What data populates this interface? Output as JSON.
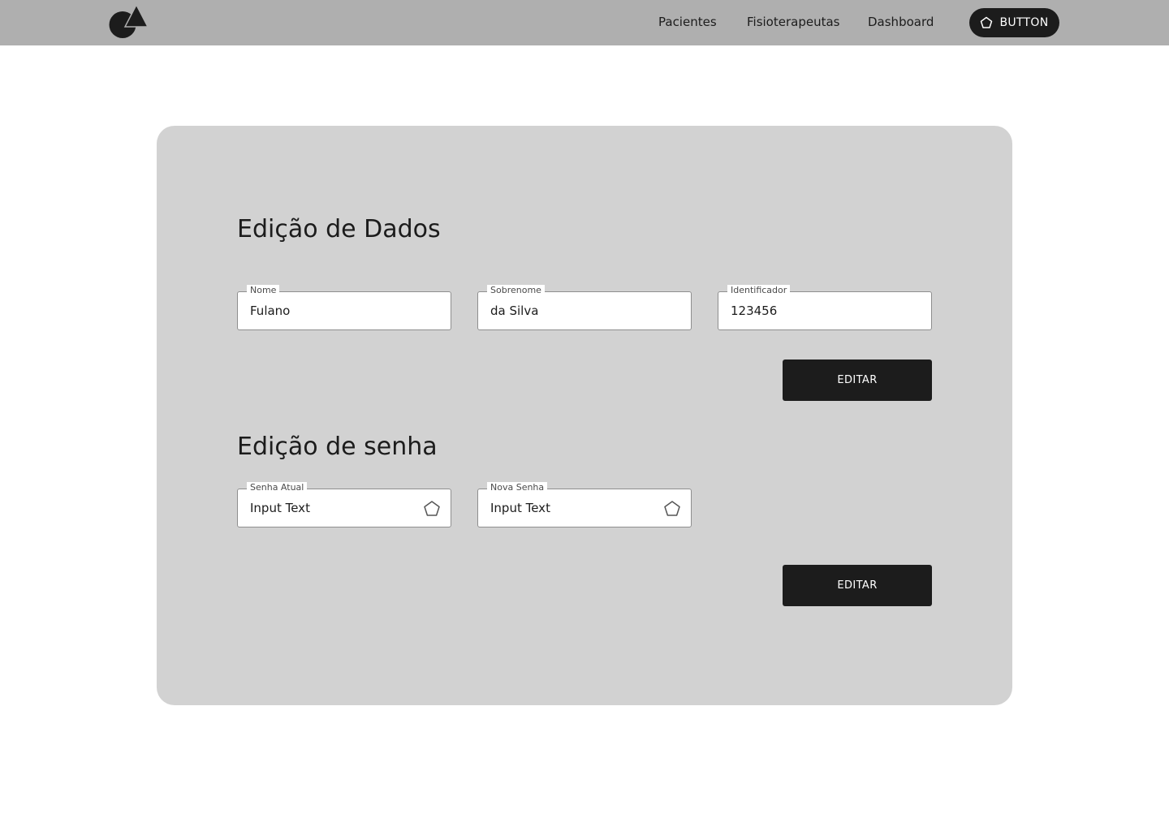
{
  "header": {
    "logo_icon": "triangle-circle-logo-icon",
    "nav": [
      {
        "label": "Pacientes"
      },
      {
        "label": "Fisioterapeutas"
      },
      {
        "label": "Dashboard"
      }
    ],
    "button": {
      "label": "BUTTON",
      "icon": "pentagon-icon"
    }
  },
  "data_section": {
    "title": "Edição de Dados",
    "fields": [
      {
        "label": "Nome",
        "value": "Fulano"
      },
      {
        "label": "Sobrenome",
        "value": "da Silva"
      },
      {
        "label": "Identificador",
        "value": "123456"
      }
    ],
    "button_label": "EDITAR"
  },
  "password_section": {
    "title": "Edição de senha",
    "fields": [
      {
        "label": "Senha Atual",
        "value": "Input Text",
        "icon": "pentagon-icon"
      },
      {
        "label": "Nova Senha",
        "value": "Input Text",
        "icon": "pentagon-icon"
      }
    ],
    "button_label": "EDITAR"
  },
  "colors": {
    "header_bg": "#afafaf",
    "card_bg": "#d2d2d2",
    "button_bg": "#1c1c1c"
  }
}
